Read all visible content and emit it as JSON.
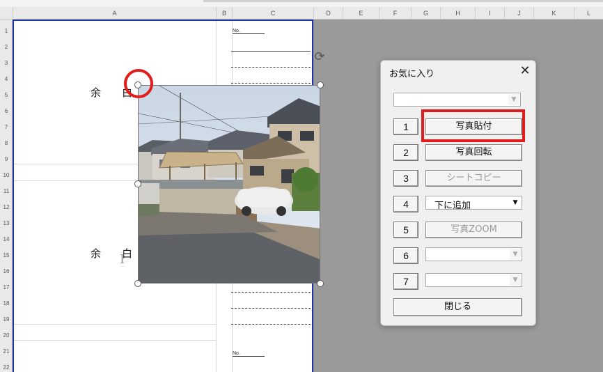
{
  "columns": [
    "A",
    "B",
    "C",
    "D",
    "E",
    "F",
    "G",
    "H",
    "I",
    "J",
    "K",
    "L"
  ],
  "rows": [
    "1",
    "2",
    "3",
    "4",
    "5",
    "6",
    "7",
    "8",
    "9",
    "10",
    "11",
    "12",
    "13",
    "14",
    "15",
    "16",
    "17",
    "18",
    "19",
    "20",
    "21",
    "22"
  ],
  "sheet": {
    "blank_top": "余　　白",
    "blank_bottom": "余　　白",
    "no_label": "No."
  },
  "dialog": {
    "title": "お気に入り",
    "close_glyph": "✕",
    "top_combo_value": "",
    "buttons": [
      {
        "num": "1",
        "label": "写真貼付",
        "enabled": true
      },
      {
        "num": "2",
        "label": "写真回転",
        "enabled": true
      },
      {
        "num": "3",
        "label": "シートコピー",
        "enabled": false
      },
      {
        "num": "4",
        "label": "下に追加",
        "enabled": true,
        "type": "combo"
      },
      {
        "num": "5",
        "label": "写真ZOOM",
        "enabled": false
      },
      {
        "num": "6",
        "label": "",
        "enabled": false,
        "type": "combo"
      },
      {
        "num": "7",
        "label": "",
        "enabled": false,
        "type": "combo"
      }
    ],
    "close_label": "閉じる"
  },
  "icons": {
    "rotate": "rotate-handle-icon",
    "dropdown": "chevron-down-icon",
    "close": "close-icon"
  },
  "colors": {
    "highlight": "#e21b1b",
    "print_border": "#2233aa"
  }
}
